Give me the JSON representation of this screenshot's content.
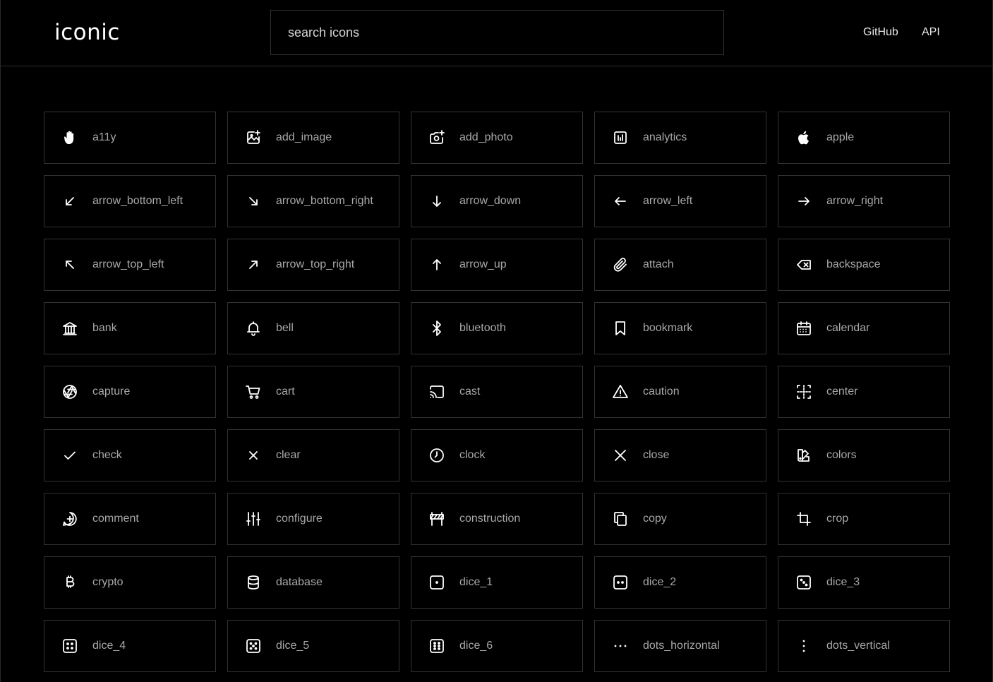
{
  "header": {
    "logo": "iconic",
    "search_placeholder": "search icons",
    "search_value": "",
    "nav": [
      {
        "label": "GitHub"
      },
      {
        "label": "API"
      }
    ]
  },
  "icons": [
    {
      "name": "a11y",
      "icon": "hand-icon"
    },
    {
      "name": "add_image",
      "icon": "add-image-icon"
    },
    {
      "name": "add_photo",
      "icon": "add-photo-icon"
    },
    {
      "name": "analytics",
      "icon": "analytics-icon"
    },
    {
      "name": "apple",
      "icon": "apple-icon"
    },
    {
      "name": "arrow_bottom_left",
      "icon": "arrow-bottom-left-icon"
    },
    {
      "name": "arrow_bottom_right",
      "icon": "arrow-bottom-right-icon"
    },
    {
      "name": "arrow_down",
      "icon": "arrow-down-icon"
    },
    {
      "name": "arrow_left",
      "icon": "arrow-left-icon"
    },
    {
      "name": "arrow_right",
      "icon": "arrow-right-icon"
    },
    {
      "name": "arrow_top_left",
      "icon": "arrow-top-left-icon"
    },
    {
      "name": "arrow_top_right",
      "icon": "arrow-top-right-icon"
    },
    {
      "name": "arrow_up",
      "icon": "arrow-up-icon"
    },
    {
      "name": "attach",
      "icon": "paperclip-icon"
    },
    {
      "name": "backspace",
      "icon": "backspace-icon"
    },
    {
      "name": "bank",
      "icon": "bank-icon"
    },
    {
      "name": "bell",
      "icon": "bell-icon"
    },
    {
      "name": "bluetooth",
      "icon": "bluetooth-icon"
    },
    {
      "name": "bookmark",
      "icon": "bookmark-icon"
    },
    {
      "name": "calendar",
      "icon": "calendar-icon"
    },
    {
      "name": "capture",
      "icon": "aperture-icon"
    },
    {
      "name": "cart",
      "icon": "cart-icon"
    },
    {
      "name": "cast",
      "icon": "cast-icon"
    },
    {
      "name": "caution",
      "icon": "warning-triangle-icon"
    },
    {
      "name": "center",
      "icon": "center-icon"
    },
    {
      "name": "check",
      "icon": "check-icon"
    },
    {
      "name": "clear",
      "icon": "clear-x-icon"
    },
    {
      "name": "clock",
      "icon": "clock-icon"
    },
    {
      "name": "close",
      "icon": "close-x-icon"
    },
    {
      "name": "colors",
      "icon": "swatch-icon"
    },
    {
      "name": "comment",
      "icon": "comment-plus-icon"
    },
    {
      "name": "configure",
      "icon": "sliders-icon"
    },
    {
      "name": "construction",
      "icon": "barrier-icon"
    },
    {
      "name": "copy",
      "icon": "copy-icon"
    },
    {
      "name": "crop",
      "icon": "crop-icon"
    },
    {
      "name": "crypto",
      "icon": "bitcoin-icon"
    },
    {
      "name": "database",
      "icon": "database-icon"
    },
    {
      "name": "dice_1",
      "icon": "dice-1-icon"
    },
    {
      "name": "dice_2",
      "icon": "dice-2-icon"
    },
    {
      "name": "dice_3",
      "icon": "dice-3-icon"
    },
    {
      "name": "dice_4",
      "icon": "dice-4-icon"
    },
    {
      "name": "dice_5",
      "icon": "dice-5-icon"
    },
    {
      "name": "dice_6",
      "icon": "dice-6-icon"
    },
    {
      "name": "dots_horizontal",
      "icon": "dots-horizontal-icon"
    },
    {
      "name": "dots_vertical",
      "icon": "dots-vertical-icon"
    }
  ]
}
